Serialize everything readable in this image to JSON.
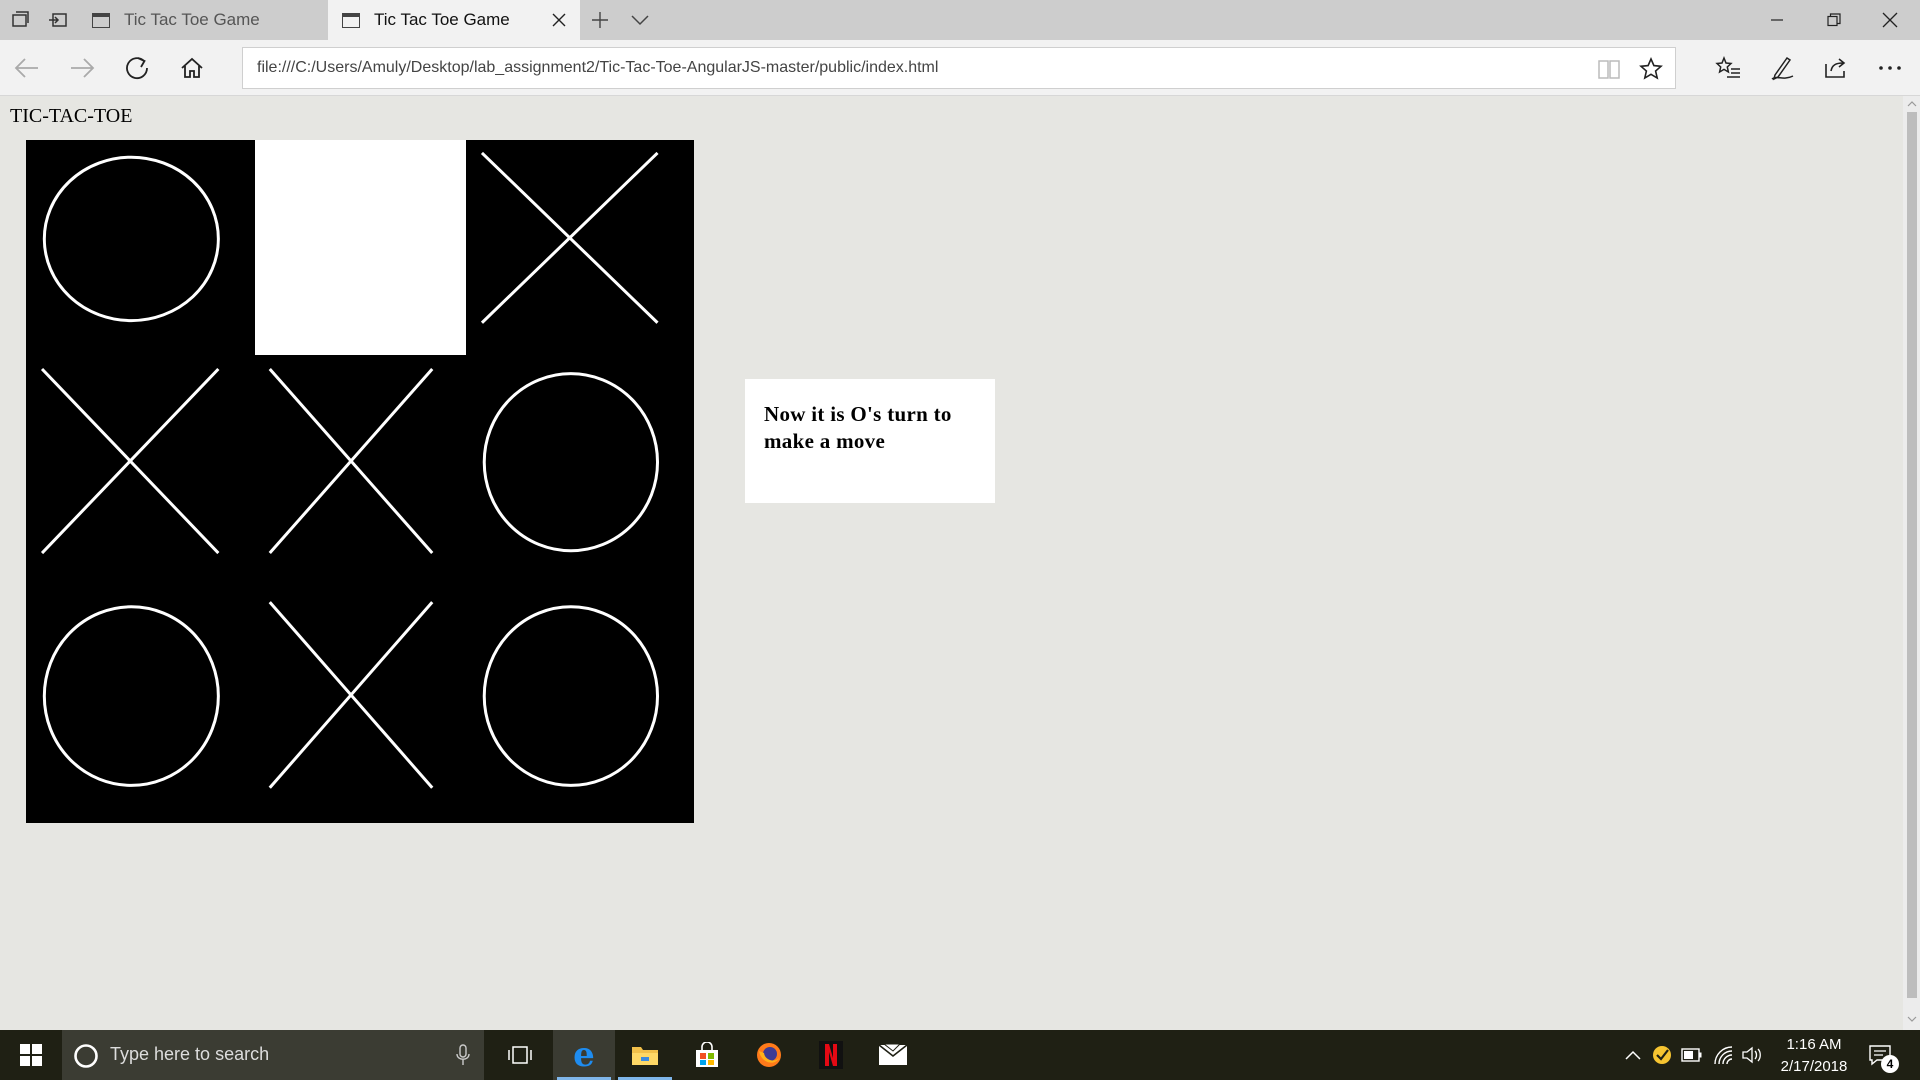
{
  "browser": {
    "tabs": [
      {
        "label": "Tic Tac Toe Game",
        "active": false
      },
      {
        "label": "Tic Tac Toe Game",
        "active": true
      }
    ],
    "address": "file:///C:/Users/Amuly/Desktop/lab_assignment2/Tic-Tac-Toe-AngularJS-master/public/index.html",
    "icons": [
      "tab-list-icon",
      "set-aside-tabs-icon",
      "new-tab-icon",
      "tab-preview-icon",
      "minimize-icon",
      "restore-icon",
      "close-icon",
      "back-icon",
      "forward-icon",
      "refresh-icon",
      "home-icon",
      "reading-view-icon",
      "favorite-star-icon",
      "favorites-hub-icon",
      "web-note-icon",
      "share-icon",
      "more-icon"
    ]
  },
  "page": {
    "heading": "TIC-TAC-TOE",
    "board": [
      "O",
      "",
      "X",
      "X",
      "X",
      "O",
      "O",
      "X",
      "O"
    ],
    "status": "Now it is O's turn to make a move"
  },
  "taskbar": {
    "search_placeholder": "Type here to search",
    "time": "1:16 AM",
    "date": "2/17/2018",
    "notification_count": "4",
    "accent_color": "#7fb6ea"
  }
}
